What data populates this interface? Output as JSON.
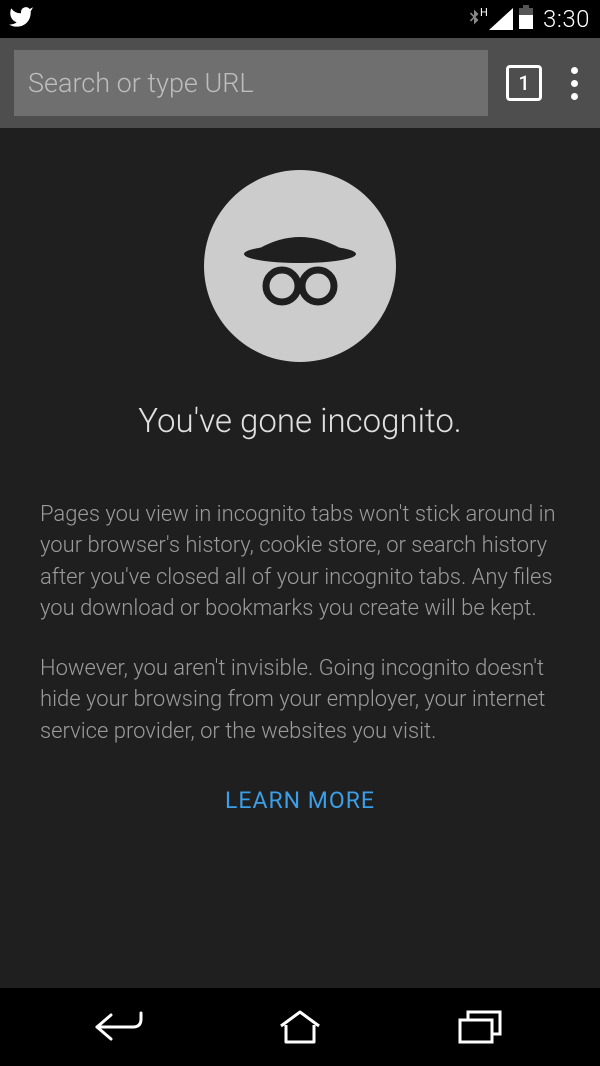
{
  "statusbar": {
    "time": "3:30",
    "network_label": "H"
  },
  "toolbar": {
    "search_placeholder": "Search or type URL",
    "tab_count": "1"
  },
  "content": {
    "heading": "You've gone incognito.",
    "paragraph1": "Pages you view in incognito tabs won't stick around in your browser's history, cookie store, or search history after you've closed all of your incognito tabs. Any files you download or bookmarks you create will be kept.",
    "paragraph2": "However, you aren't invisible. Going incognito doesn't hide your browsing from your employer, your internet service provider, or the websites you visit.",
    "learn_more": "LEARN MORE"
  }
}
